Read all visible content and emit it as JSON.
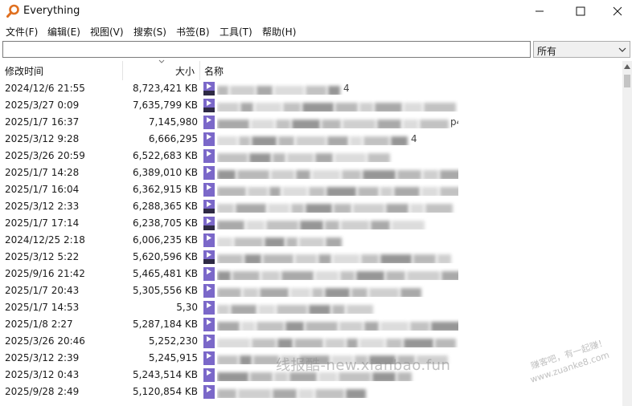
{
  "window": {
    "title": "Everything"
  },
  "menu": [
    "文件(F)",
    "编辑(E)",
    "视图(V)",
    "搜索(S)",
    "书签(B)",
    "工具(T)",
    "帮助(H)"
  ],
  "search": {
    "value": "",
    "placeholder": ""
  },
  "filter": {
    "selected": "所有"
  },
  "columns": {
    "modified": "修改时间",
    "size": "大小",
    "name": "名称"
  },
  "rows": [
    {
      "date": "2024/12/6 21:55",
      "size": "8,723,421 KB",
      "name_visible": "4",
      "icon": "video-mp4-icon"
    },
    {
      "date": "2025/3/27 0:09",
      "size": "7,635,799 KB",
      "name_visible": "",
      "icon": "video-mp4-icon"
    },
    {
      "date": "2025/1/7 16:37",
      "size": "7,145,980",
      "name_visible": "p4",
      "icon": "video-file-icon"
    },
    {
      "date": "2025/3/12 9:28",
      "size": "6,666,295",
      "name_visible": "4",
      "icon": "video-file-icon"
    },
    {
      "date": "2025/3/26 20:59",
      "size": "6,522,683 KB",
      "name_visible": "",
      "icon": "video-file-icon"
    },
    {
      "date": "2025/1/7 14:28",
      "size": "6,389,010 KB",
      "name_visible": "",
      "icon": "video-file-icon"
    },
    {
      "date": "2025/1/7 16:04",
      "size": "6,362,915 KB",
      "name_visible": "",
      "icon": "video-file-icon"
    },
    {
      "date": "2025/3/12 2:33",
      "size": "6,288,365 KB",
      "name_visible": "",
      "icon": "video-mp4-icon"
    },
    {
      "date": "2025/1/7 17:14",
      "size": "6,238,705 KB",
      "name_visible": "",
      "icon": "video-mp4-icon"
    },
    {
      "date": "2024/12/25 2:18",
      "size": "6,006,235 KB",
      "name_visible": "",
      "icon": "video-file-icon"
    },
    {
      "date": "2025/3/12 5:22",
      "size": "5,620,596 KB",
      "name_visible": "",
      "icon": "video-mp4-icon"
    },
    {
      "date": "2025/9/16 21:42",
      "size": "5,465,481 KB",
      "name_visible": "",
      "icon": "video-file-icon"
    },
    {
      "date": "2025/1/7 20:43",
      "size": "5,305,556 KB",
      "name_visible": "",
      "icon": "video-file-icon"
    },
    {
      "date": "2025/1/7 14:53",
      "size": "5,30",
      "name_visible": "",
      "icon": "video-file-icon"
    },
    {
      "date": "2025/1/8 2:27",
      "size": "5,287,184 KB",
      "name_visible": "",
      "icon": "video-file-icon"
    },
    {
      "date": "2025/3/26 20:46",
      "size": "5,252,230",
      "name_visible": "",
      "icon": "video-file-icon"
    },
    {
      "date": "2025/3/12 2:39",
      "size": "5,245,915",
      "name_visible": "",
      "icon": "video-file-icon"
    },
    {
      "date": "2025/3/12 0:43",
      "size": "5,243,514 KB",
      "name_visible": "",
      "icon": "video-file-icon"
    },
    {
      "date": "2025/9/28 2:49",
      "size": "5,120,854 KB",
      "name_visible": "",
      "icon": "video-file-icon"
    }
  ],
  "watermark": {
    "text": "线报酷-new.xianbao.fun",
    "stamp_line1": "赚客吧，有一起赚！",
    "stamp_line2": "www.zuanke8.com"
  },
  "colors": {
    "icon_purple": "#7b68c9",
    "icon_dark": "#2e2a44",
    "accent": "#e07020"
  }
}
